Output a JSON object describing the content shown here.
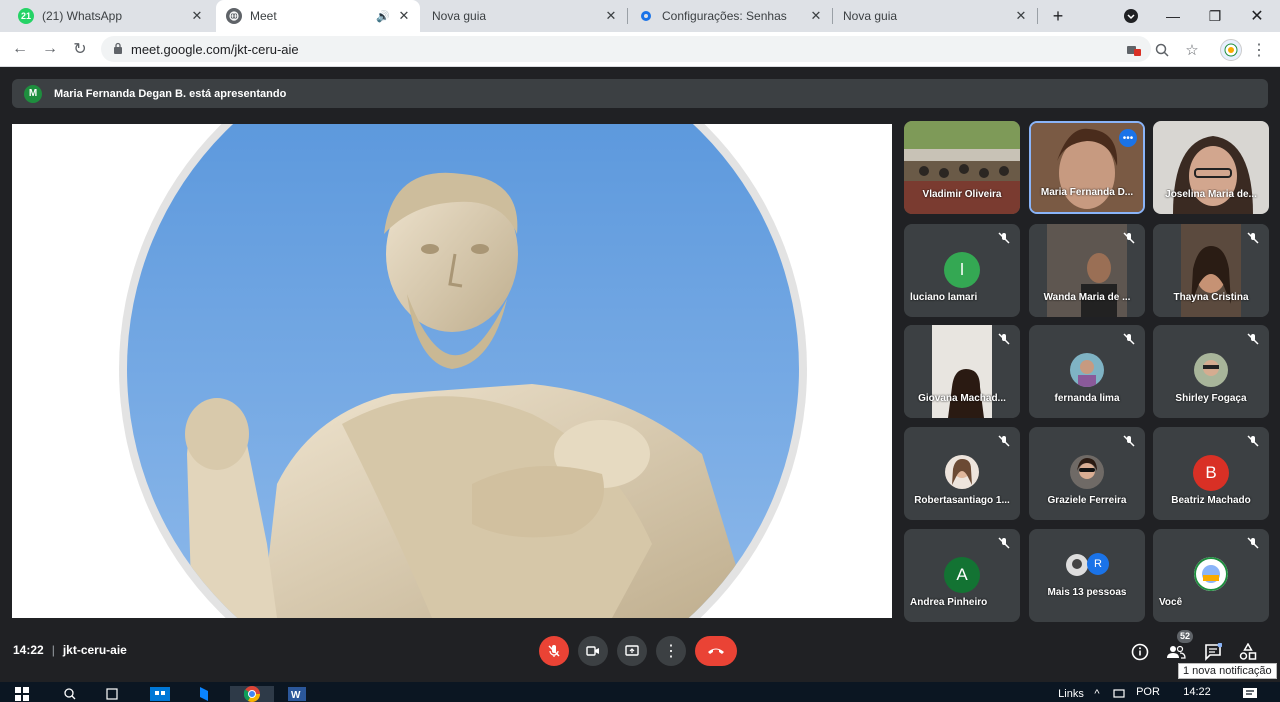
{
  "browser": {
    "tabs": [
      {
        "title": "(21) WhatsApp",
        "badge": "21"
      },
      {
        "title": "Meet",
        "active": true
      },
      {
        "title": "Nova guia"
      },
      {
        "title": "Configurações: Senhas"
      },
      {
        "title": "Nova guia"
      }
    ],
    "url": "meet.google.com/jkt-ceru-aie"
  },
  "meet": {
    "presenter_initial": "M",
    "presenter_banner": "Maria Fernanda Degan B. está apresentando",
    "participants": [
      {
        "name": "Vladimir Oliveira",
        "type": "video"
      },
      {
        "name": "Maria Fernanda D...",
        "type": "video",
        "highlight": true
      },
      {
        "name": "Joselina Maria de...",
        "type": "video"
      },
      {
        "name": "luciano lamari",
        "type": "letter",
        "letter": "l",
        "color": "#34a853"
      },
      {
        "name": "Wanda Maria de ...",
        "type": "video"
      },
      {
        "name": "Thayna Cristina",
        "type": "video"
      },
      {
        "name": "Giovana Machad...",
        "type": "video"
      },
      {
        "name": "fernanda lima",
        "type": "photo"
      },
      {
        "name": "Shirley Fogaça",
        "type": "photo"
      },
      {
        "name": "Robertasantiago 1...",
        "type": "photo"
      },
      {
        "name": "Graziele Ferreira",
        "type": "photo"
      },
      {
        "name": "Beatriz Machado",
        "type": "letter",
        "letter": "B",
        "color": "#d93025"
      },
      {
        "name": "Andrea Pinheiro",
        "type": "letter",
        "letter": "A",
        "color": "#137333"
      },
      {
        "name": "Mais 13 pessoas",
        "type": "more",
        "letter": "R"
      },
      {
        "name": "Você",
        "type": "photo"
      }
    ],
    "time": "14:22",
    "meeting_code": "jkt-ceru-aie",
    "participant_count": "52",
    "notification_tooltip": "1 nova notificação",
    "colors": {
      "end_call": "#ea4335",
      "accent": "#1a73e8"
    }
  },
  "taskbar": {
    "links_label": "Links",
    "language": "POR",
    "clock": "14:22"
  }
}
